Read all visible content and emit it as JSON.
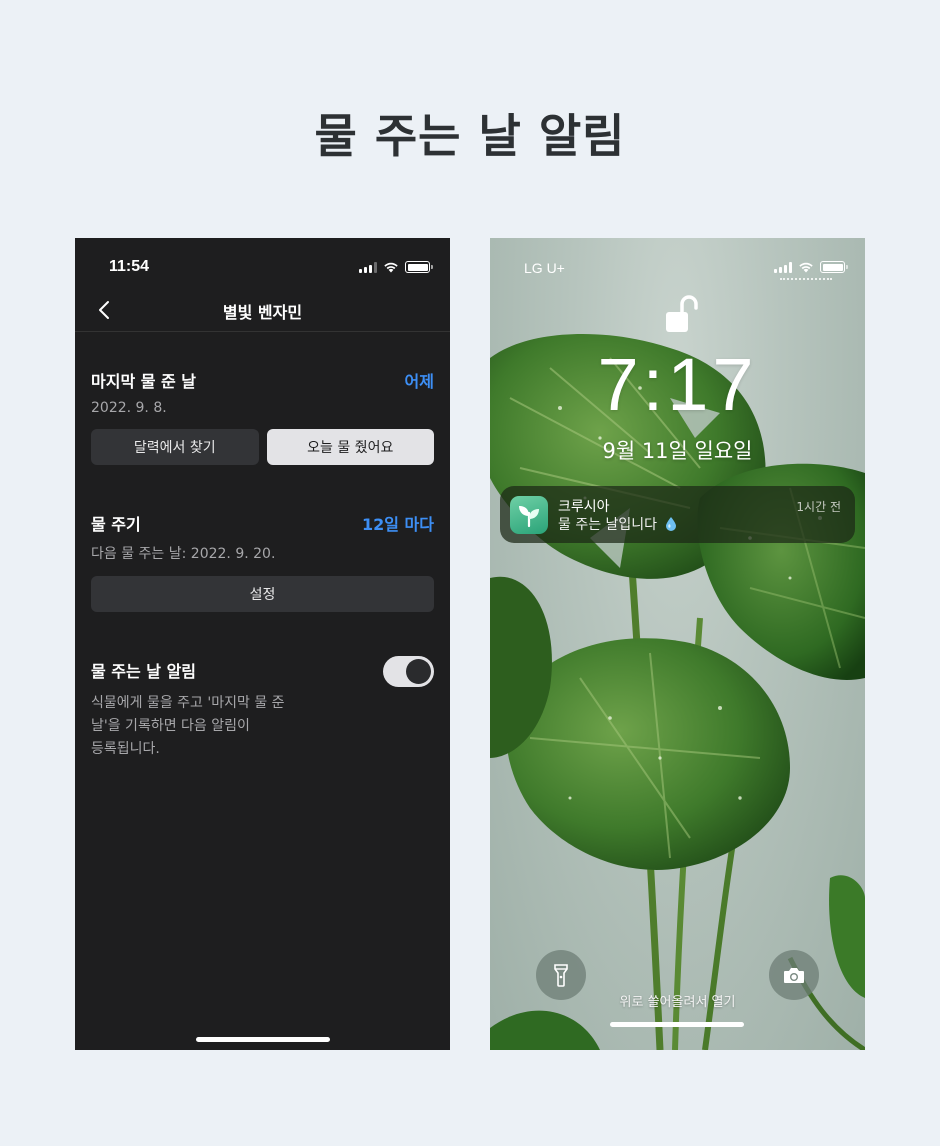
{
  "page": {
    "title": "물 주는 날 알림"
  },
  "left_phone": {
    "status_bar": {
      "time": "11:54"
    },
    "nav": {
      "title": "별빛 벤자민"
    },
    "last_watered": {
      "title": "마지막 물 준 날",
      "value": "어제",
      "date": "2022. 9. 8.",
      "find_in_calendar_label": "달력에서 찾기",
      "watered_today_label": "오늘 물 줬어요"
    },
    "watering_cycle": {
      "title": "물 주기",
      "value": "12일 마다",
      "next_date": "다음 물 주는 날: 2022. 9. 20.",
      "settings_label": "설정"
    },
    "reminder": {
      "title": "물 주는 날 알림",
      "enabled": true,
      "description_lines": [
        "식물에게 물을 주고 '마지막 물 준",
        "날'을 기록하면 다음 알림이",
        "등록됩니다."
      ]
    }
  },
  "right_phone": {
    "status_bar": {
      "carrier": "LG U+"
    },
    "clock": "7:17",
    "date": "9월 11일 일요일",
    "notification": {
      "app_name": "크루시아",
      "time": "1시간 전",
      "message": "물 주는 날입니다",
      "icon": "seedling-icon"
    },
    "swipe_hint": "위로 쓸어올려서 열기"
  },
  "colors": {
    "background": "#ecf1f6",
    "dark_screen": "#1e1e1f",
    "accent_blue": "#3d8ff5",
    "app_icon": "#3bb888"
  }
}
